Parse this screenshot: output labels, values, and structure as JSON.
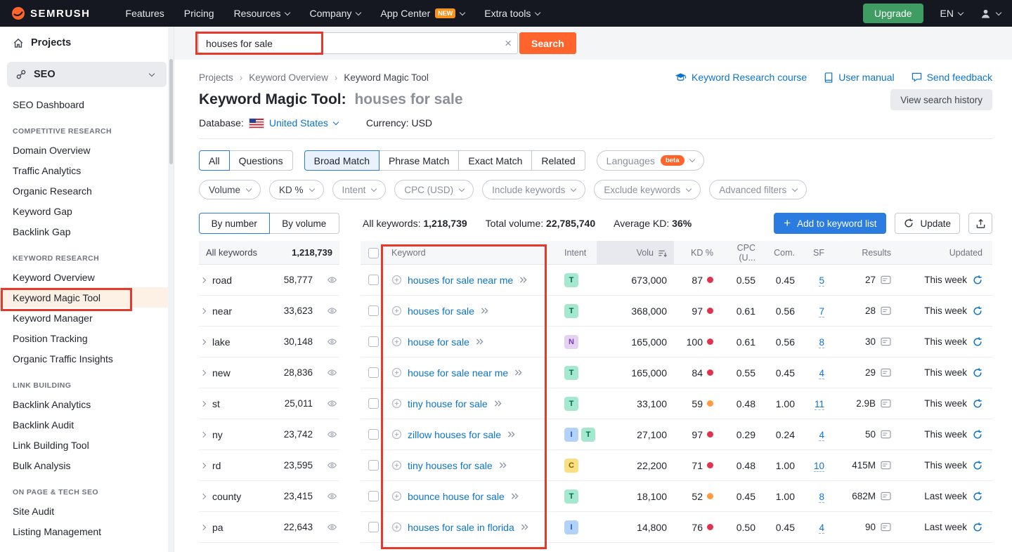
{
  "colors": {
    "accent_orange": "#ff642d",
    "link_blue": "#0d74cc",
    "button_blue": "#2b7ce0",
    "upgrade_green": "#3f9d63",
    "annotation_red": "#e5392c",
    "kd_red": "#e0334d",
    "kd_orange": "#ff9a3d"
  },
  "intent_colors": {
    "T": {
      "bg": "#a3e8cf",
      "fg": "#006a4d"
    },
    "N": {
      "bg": "#e4d2f3",
      "fg": "#7a3daf"
    },
    "C": {
      "bg": "#fbdf83",
      "fg": "#7d6200"
    },
    "I": {
      "bg": "#b3d2f9",
      "fg": "#1a57c2"
    }
  },
  "navbar": {
    "logo_text": "SEMRUSH",
    "items": [
      {
        "label": "Features",
        "dropdown": false
      },
      {
        "label": "Pricing",
        "dropdown": false
      },
      {
        "label": "Resources",
        "dropdown": true
      },
      {
        "label": "Company",
        "dropdown": true
      },
      {
        "label": "App Center",
        "dropdown": true,
        "badge": "NEW"
      },
      {
        "label": "Extra tools",
        "dropdown": true
      }
    ],
    "upgrade_label": "Upgrade",
    "language": "EN"
  },
  "sidebar": {
    "projects_label": "Projects",
    "seo_label": "SEO",
    "active_item": "Keyword Magic Tool",
    "groups": [
      {
        "header": null,
        "items": [
          "SEO Dashboard"
        ]
      },
      {
        "header": "COMPETITIVE RESEARCH",
        "items": [
          "Domain Overview",
          "Traffic Analytics",
          "Organic Research",
          "Keyword Gap",
          "Backlink Gap"
        ]
      },
      {
        "header": "KEYWORD RESEARCH",
        "items": [
          "Keyword Overview",
          "Keyword Magic Tool",
          "Keyword Manager",
          "Position Tracking",
          "Organic Traffic Insights"
        ]
      },
      {
        "header": "LINK BUILDING",
        "items": [
          "Backlink Analytics",
          "Backlink Audit",
          "Link Building Tool",
          "Bulk Analysis"
        ]
      },
      {
        "header": "ON PAGE & TECH SEO",
        "items": [
          "Site Audit",
          "Listing Management"
        ]
      }
    ]
  },
  "search": {
    "value": "houses for sale",
    "button_label": "Search"
  },
  "breadcrumb": [
    "Projects",
    "Keyword Overview",
    "Keyword Magic Tool"
  ],
  "header_links": [
    "Keyword Research course",
    "User manual",
    "Send feedback"
  ],
  "page": {
    "title_prefix": "Keyword Magic Tool:",
    "title_query": "houses for sale",
    "history_button": "View search history",
    "database_label": "Database:",
    "database_value": "United States",
    "currency_text": "Currency: USD"
  },
  "tabs": {
    "items": [
      {
        "label": "All",
        "state": "selected"
      },
      {
        "label": "Questions",
        "state": "normal"
      },
      {
        "label": "Broad Match",
        "state": "active"
      },
      {
        "label": "Phrase Match",
        "state": "normal"
      },
      {
        "label": "Exact Match",
        "state": "normal"
      },
      {
        "label": "Related",
        "state": "normal"
      }
    ],
    "languages_label": "Languages",
    "languages_badge": "beta"
  },
  "filters": [
    {
      "label": "Volume",
      "active": true
    },
    {
      "label": "KD %",
      "active": true
    },
    {
      "label": "Intent",
      "active": false
    },
    {
      "label": "CPC (USD)",
      "active": false
    },
    {
      "label": "Include keywords",
      "active": false
    },
    {
      "label": "Exclude keywords",
      "active": false
    },
    {
      "label": "Advanced filters",
      "active": false
    }
  ],
  "toolbar": {
    "by_number": "By number",
    "by_volume": "By volume",
    "all_keywords_label": "All keywords:",
    "all_keywords_value": "1,218,739",
    "total_volume_label": "Total volume:",
    "total_volume_value": "22,785,740",
    "avg_kd_label": "Average KD:",
    "avg_kd_value": "36%",
    "add_button": "Add to keyword list",
    "update_button": "Update"
  },
  "groups_panel": {
    "header_label": "All keywords",
    "header_value": "1,218,739",
    "rows": [
      {
        "term": "road",
        "count": "58,777"
      },
      {
        "term": "near",
        "count": "33,623"
      },
      {
        "term": "lake",
        "count": "30,148"
      },
      {
        "term": "new",
        "count": "28,836"
      },
      {
        "term": "st",
        "count": "25,011"
      },
      {
        "term": "ny",
        "count": "23,742"
      },
      {
        "term": "rd",
        "count": "23,595"
      },
      {
        "term": "county",
        "count": "23,415"
      },
      {
        "term": "pa",
        "count": "22,643"
      }
    ]
  },
  "table": {
    "headers": {
      "keyword": "Keyword",
      "intent": "Intent",
      "volume": "Volu",
      "kd": "KD %",
      "cpc": "CPC (U...",
      "com": "Com.",
      "sf": "SF",
      "results": "Results",
      "updated": "Updated"
    },
    "rows": [
      {
        "keyword": "houses for sale near me",
        "intent": [
          "T"
        ],
        "volume": "673,000",
        "kd": "87",
        "kd_level": "red",
        "cpc": "0.55",
        "com": "0.45",
        "sf": "5",
        "results": "27",
        "updated": "This week"
      },
      {
        "keyword": "houses for sale",
        "intent": [
          "T"
        ],
        "volume": "368,000",
        "kd": "97",
        "kd_level": "red",
        "cpc": "0.61",
        "com": "0.56",
        "sf": "7",
        "results": "28",
        "updated": "This week"
      },
      {
        "keyword": "house for sale",
        "intent": [
          "N"
        ],
        "volume": "165,000",
        "kd": "100",
        "kd_level": "red",
        "cpc": "0.61",
        "com": "0.56",
        "sf": "8",
        "results": "30",
        "updated": "This week"
      },
      {
        "keyword": "house for sale near me",
        "intent": [
          "T"
        ],
        "volume": "165,000",
        "kd": "84",
        "kd_level": "red",
        "cpc": "0.55",
        "com": "0.45",
        "sf": "4",
        "results": "29",
        "updated": "This week"
      },
      {
        "keyword": "tiny house for sale",
        "intent": [
          "T"
        ],
        "volume": "33,100",
        "kd": "59",
        "kd_level": "orange",
        "cpc": "0.48",
        "com": "1.00",
        "sf": "11",
        "results": "2.9B",
        "updated": "This week"
      },
      {
        "keyword": "zillow houses for sale",
        "intent": [
          "I",
          "T"
        ],
        "volume": "27,100",
        "kd": "97",
        "kd_level": "red",
        "cpc": "0.29",
        "com": "0.24",
        "sf": "4",
        "results": "50",
        "updated": "This week"
      },
      {
        "keyword": "tiny houses for sale",
        "intent": [
          "C"
        ],
        "volume": "22,200",
        "kd": "71",
        "kd_level": "red",
        "cpc": "0.48",
        "com": "1.00",
        "sf": "10",
        "results": "415M",
        "updated": "This week"
      },
      {
        "keyword": "bounce house for sale",
        "intent": [
          "T"
        ],
        "volume": "18,100",
        "kd": "52",
        "kd_level": "orange",
        "cpc": "0.45",
        "com": "1.00",
        "sf": "8",
        "results": "682M",
        "updated": "Last week"
      },
      {
        "keyword": "houses for sale in florida",
        "intent": [
          "I"
        ],
        "volume": "14,800",
        "kd": "76",
        "kd_level": "red",
        "cpc": "0.50",
        "com": "0.45",
        "sf": "4",
        "results": "90",
        "updated": "Last week"
      }
    ]
  }
}
